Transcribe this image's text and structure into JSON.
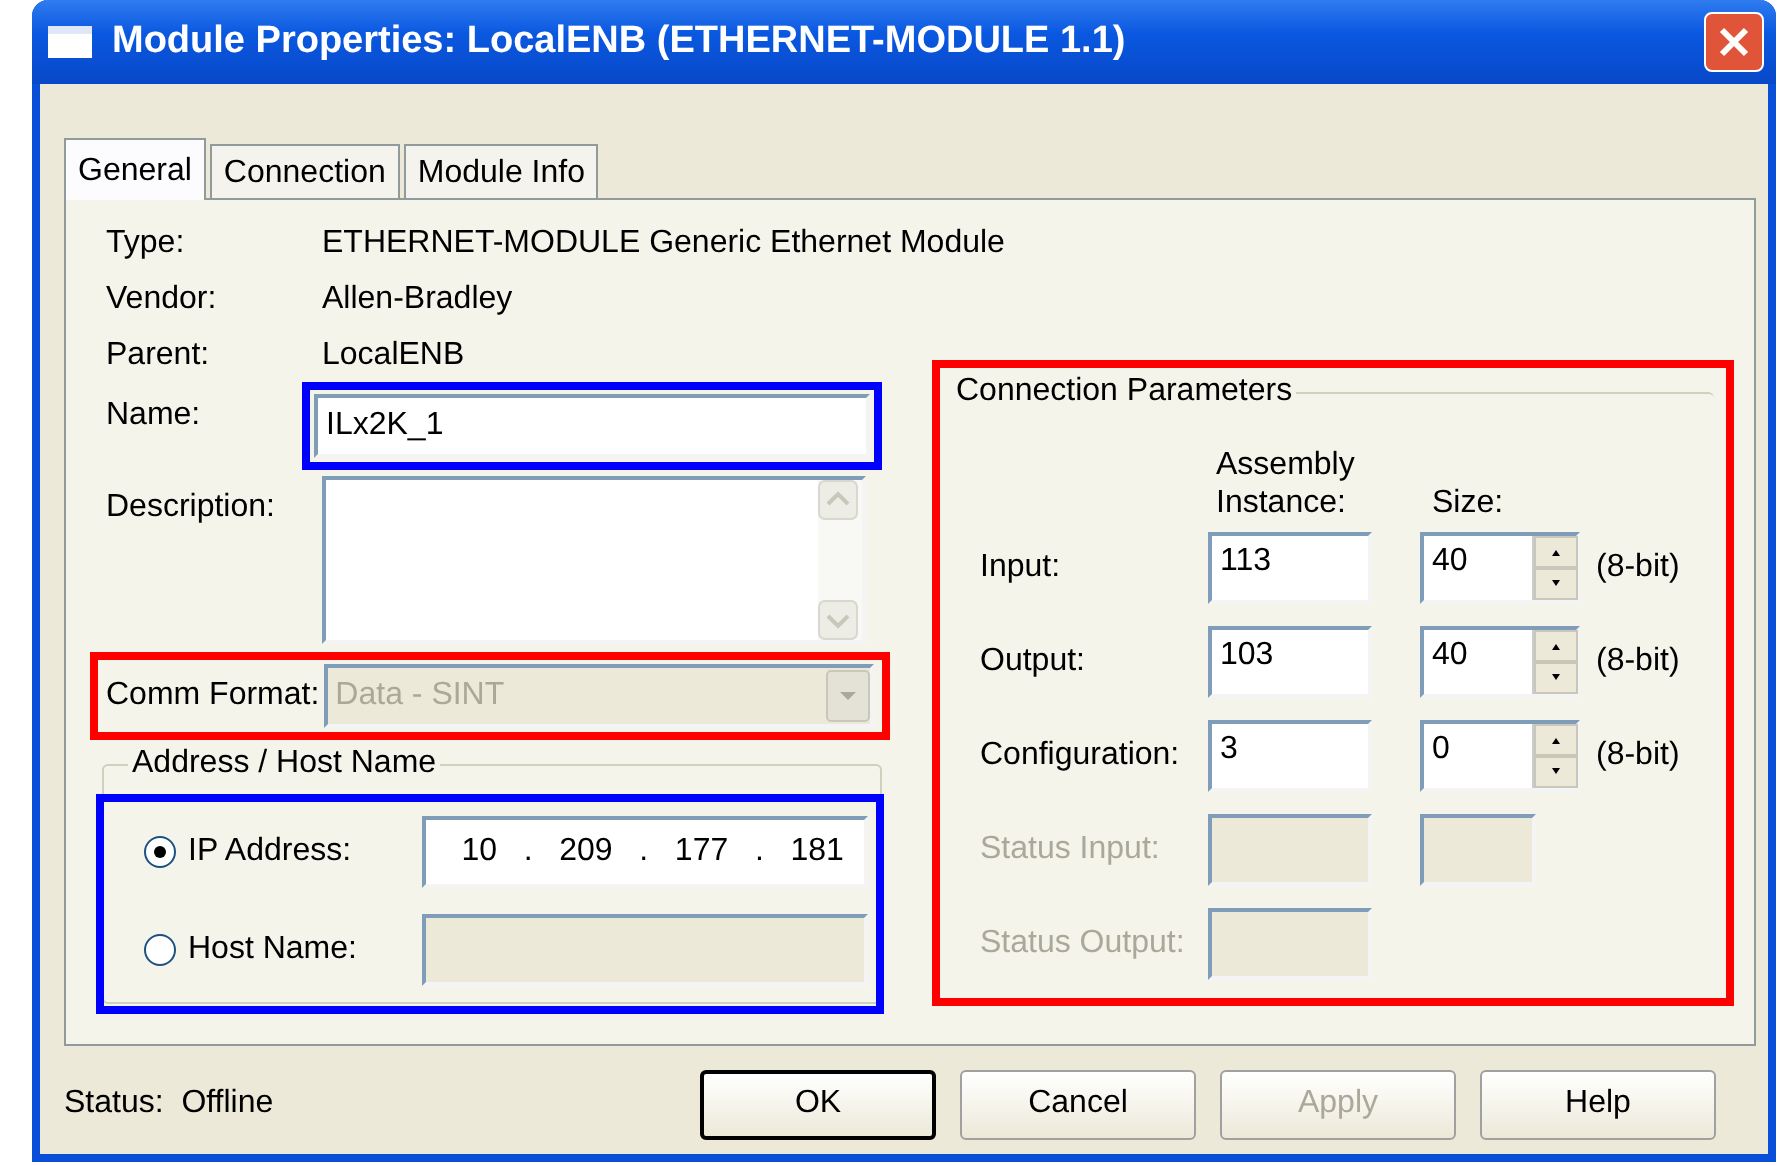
{
  "window": {
    "title": "Module Properties: LocalENB (ETHERNET-MODULE 1.1)"
  },
  "tabs": [
    {
      "label": "General",
      "selected": true
    },
    {
      "label": "Connection",
      "selected": false
    },
    {
      "label": "Module Info",
      "selected": false
    }
  ],
  "general": {
    "info": [
      {
        "label": "Type:",
        "value": "ETHERNET-MODULE Generic Ethernet Module"
      },
      {
        "label": "Vendor:",
        "value": "Allen-Bradley"
      },
      {
        "label": "Parent:",
        "value": "LocalENB"
      }
    ],
    "name": {
      "label": "Name:",
      "value": "ILx2K_1",
      "color": "#0000ff"
    },
    "description": {
      "label": "Description:"
    },
    "comm_format": {
      "label": "Comm Format:",
      "value": "Data - SINT",
      "disabled": true,
      "color": "#ff0000"
    },
    "address": {
      "title": "Address / Host Name",
      "color": "#0000ff",
      "options": [
        {
          "label": "IP Address:",
          "selected": true,
          "kind": "ip",
          "octets": [
            "10",
            "209",
            "177",
            "181"
          ],
          "separator": "."
        },
        {
          "label": "Host Name:",
          "selected": false,
          "kind": "text"
        }
      ]
    },
    "connection_parameters": {
      "title": "Connection Parameters",
      "color": "#ff0000",
      "columns": [
        "Assembly Instance:",
        "Size:"
      ],
      "rows": [
        {
          "label": "Input:",
          "disabled": false,
          "instance": "113",
          "size": "40",
          "unit": "(8-bit)"
        },
        {
          "label": "Output:",
          "disabled": false,
          "instance": "103",
          "size": "40",
          "unit": "(8-bit)"
        },
        {
          "label": "Configuration:",
          "disabled": false,
          "instance": "3",
          "size": "0",
          "unit": "(8-bit)"
        },
        {
          "label": "Status Input:",
          "disabled": true,
          "has_size": true
        },
        {
          "label": "Status Output:",
          "disabled": true,
          "has_size": false
        }
      ]
    }
  },
  "status": {
    "label": "Status:",
    "value": "Offline"
  },
  "buttons": [
    {
      "label": "OK",
      "default": true,
      "disabled": false
    },
    {
      "label": "Cancel",
      "default": false,
      "disabled": false
    },
    {
      "label": "Apply",
      "default": false,
      "disabled": true
    },
    {
      "label": "Help",
      "default": false,
      "disabled": false
    }
  ]
}
